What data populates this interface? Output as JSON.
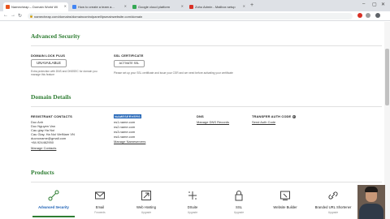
{
  "browser": {
    "tabs": [
      {
        "label": "Namecheap – Domain World Wi",
        "favicon_color": "#e8541e",
        "active": true
      },
      {
        "label": "How to create a team a...",
        "favicon_color": "#4285f4",
        "active": false
      },
      {
        "label": "Google cloud platform",
        "favicon_color": "#34a853",
        "active": false
      },
      {
        "label": "Zoho Admin - Mailbox setup",
        "favicon_color": "#d93025",
        "active": false
      }
    ],
    "url": "namecheap.com/domains/domaincontrolpanel/lpsmainwebsite.com/domain"
  },
  "advanced_security": {
    "title": "Advanced Security",
    "domain_lock_label": "DOMAIN LOCK PLUS",
    "domain_lock_button": "UNAVAILABLE",
    "domain_lock_note": "Extra protection with DNS and DNSSEC for domain you manage this feature",
    "ssl_label": "SSL CERTIFICATE",
    "ssl_button": "ACTIVATE SSL",
    "ssl_note": "Please set up your SSL certificate and issue your CSR and we need before activating your certificate"
  },
  "domain_details": {
    "title": "Domain Details",
    "registrant_label": "REGISTRANT CONTACTS",
    "registrant_lines": [
      "Duc Anh",
      "Duc Nguyen Van",
      "Cau giay Ha Noi",
      "Cau Giay, Ha Noi VietNam VN",
      "ducnoname@gmail.com",
      "+84.924462950"
    ],
    "registrant_link": "Manage Contacts",
    "nameservers_label": "NAMESERVERS",
    "nameservers": [
      "ns1.name.com",
      "ns2.name.com",
      "ns3.name.com",
      "ns4.name.com"
    ],
    "nameservers_link": "Manage Nameservers",
    "dns_label": "DNS",
    "dns_link": "Manage DNS Records",
    "transfer_label": "TRANSFER AUTH CODE",
    "transfer_info": "?",
    "transfer_link": "Send Auth Code"
  },
  "products": {
    "title": "Products",
    "items": [
      {
        "name": "Advanced Security",
        "sub": "",
        "icon": "shield-link-icon"
      },
      {
        "name": "Email",
        "sub": "Forwards",
        "icon": "mail-icon"
      },
      {
        "name": "Web Hosting",
        "sub": "Upgrade",
        "icon": "hosting-arrow-icon"
      },
      {
        "name": "DSuite",
        "sub": "Upgrade",
        "icon": "plus-grid-icon"
      },
      {
        "name": "SSL",
        "sub": "Upgrade",
        "icon": "lock-icon"
      },
      {
        "name": "Website Builder",
        "sub": "",
        "icon": "builder-icon"
      },
      {
        "name": "Branded URL Shortener",
        "sub": "Upgrade",
        "icon": "url-shortener-icon"
      }
    ]
  },
  "colors": {
    "brand_green": "#2e7d32",
    "link_blue": "#1a73e8",
    "selection_blue": "#1a5fb4"
  }
}
